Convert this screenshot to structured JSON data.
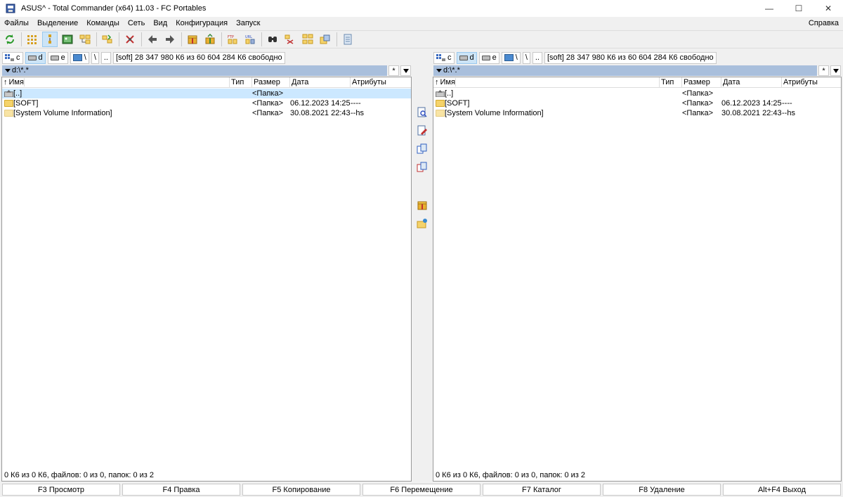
{
  "window": {
    "title": "ASUS^ - Total Commander (x64) 11.03 - FC Portables",
    "minimize": "—",
    "maximize": "☐",
    "close": "✕"
  },
  "menu": {
    "items": [
      "Файлы",
      "Выделение",
      "Команды",
      "Сеть",
      "Вид",
      "Конфигурация",
      "Запуск"
    ],
    "help": "Справка"
  },
  "toolbar": {
    "icons": [
      "refresh-icon",
      "brief-view-icon",
      "tree-view-icon",
      "thumbnail-view-icon",
      "tree-folders-icon",
      "compare-dirs-icon",
      "multi-rename-icon",
      "back-icon",
      "forward-icon",
      "pack-icon",
      "unpack-icon",
      "ftp-connect-icon",
      "url-connect-icon",
      "search-icon",
      "sync-dirs-icon",
      "network-icon",
      "copy-names-icon",
      "notepad-icon"
    ]
  },
  "left_panel": {
    "drives": [
      {
        "label": "c"
      },
      {
        "label": "d"
      },
      {
        "label": "e"
      }
    ],
    "net_label": "\\",
    "root_btn": "\\",
    "up_btn": "..",
    "drive_info": "[soft]  28 347 980 К6 из 60 604 284 К6 свободно",
    "path": "d:\\*.*",
    "filter_btn": "*",
    "columns": {
      "name": "Имя",
      "type": "Тип",
      "size": "Размер",
      "date": "Дата",
      "attr": "Атрибуты"
    },
    "rows": [
      {
        "name": "[..]",
        "type": "",
        "size": "<Папка>",
        "date": "",
        "attr": ""
      },
      {
        "name": "[SOFT]",
        "type": "",
        "size": "<Папка>",
        "date": "06.12.2023 14:25",
        "attr": "----"
      },
      {
        "name": "[System Volume Information]",
        "type": "",
        "size": "<Папка>",
        "date": "30.08.2021 22:43",
        "attr": "--hs"
      }
    ],
    "status": "0 К6 из 0 К6, файлов: 0 из 0, папок: 0 из 2"
  },
  "right_panel": {
    "drives": [
      {
        "label": "c"
      },
      {
        "label": "d"
      },
      {
        "label": "e"
      }
    ],
    "net_label": "\\",
    "root_btn": "\\",
    "up_btn": "..",
    "drive_info": "[soft]  28 347 980 К6 из 60 604 284 К6 свободно",
    "path": "d:\\*.*",
    "filter_btn": "*",
    "columns": {
      "name": "Имя",
      "type": "Тип",
      "size": "Размер",
      "date": "Дата",
      "attr": "Атрибуты"
    },
    "rows": [
      {
        "name": "[..]",
        "type": "",
        "size": "<Папка>",
        "date": "",
        "attr": ""
      },
      {
        "name": "[SOFT]",
        "type": "",
        "size": "<Папка>",
        "date": "06.12.2023 14:25",
        "attr": "----"
      },
      {
        "name": "[System Volume Information]",
        "type": "",
        "size": "<Папка>",
        "date": "30.08.2021 22:43",
        "attr": "--hs"
      }
    ],
    "status": "0 К6 из 0 К6, файлов: 0 из 0, папок: 0 из 2"
  },
  "middle_toolbar": {
    "icons": [
      "view-file-icon",
      "edit-file-icon",
      "copy-file-icon",
      "move-file-icon",
      "pack-files-icon",
      "new-folder-icon"
    ]
  },
  "fkeys": [
    "F3 Просмотр",
    "F4 Правка",
    "F5 Копирование",
    "F6 Перемещение",
    "F7 Каталог",
    "F8 Удаление",
    "Alt+F4 Выход"
  ],
  "colors": {
    "selection": "#cce8ff",
    "path_bar": "#a9bfdc",
    "folder": "#f5d36b"
  }
}
